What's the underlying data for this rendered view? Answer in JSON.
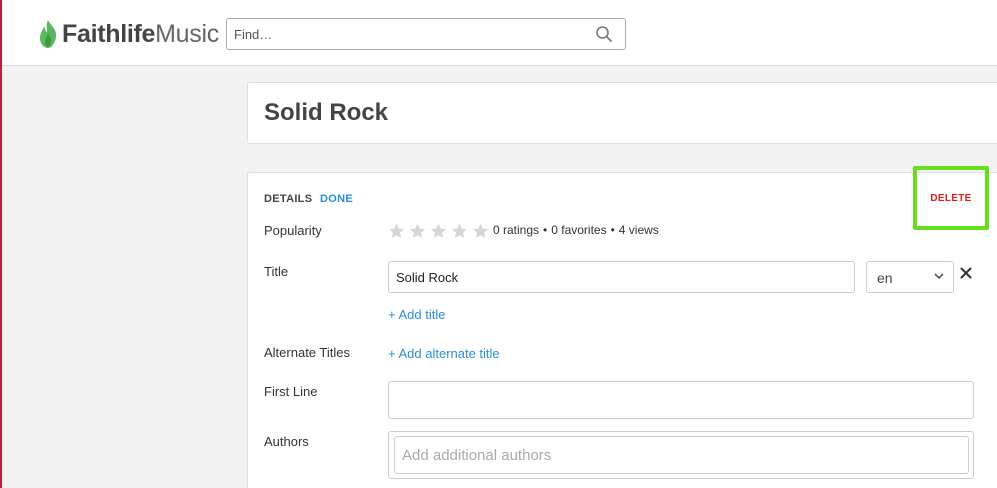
{
  "header": {
    "logo_bold": "Faithlife",
    "logo_light": "Music",
    "search_placeholder": "Find…"
  },
  "song": {
    "title": "Solid Rock"
  },
  "details": {
    "tab_details": "DETAILS",
    "tab_done": "DONE",
    "delete_label": "DELETE",
    "popularity_label": "Popularity",
    "rating_stars": 0,
    "ratings": "0 ratings",
    "favorites": "0 favorites",
    "views": "4 views",
    "stat_separator": "•",
    "title_label": "Title",
    "title_value": "Solid Rock",
    "language_value": "en",
    "add_title_link": "+ Add title",
    "alternate_titles_label": "Alternate Titles",
    "add_alternate_title_link": "+ Add alternate title",
    "first_line_label": "First Line",
    "first_line_value": "",
    "authors_label": "Authors",
    "authors_placeholder": "Add additional authors"
  },
  "colors": {
    "accent_link": "#2a8fd6",
    "delete_red": "#e01e1e",
    "highlight_green": "#66e01c",
    "brand_left_edge": "#b81f3f",
    "logo_green": "#5cb85c"
  }
}
